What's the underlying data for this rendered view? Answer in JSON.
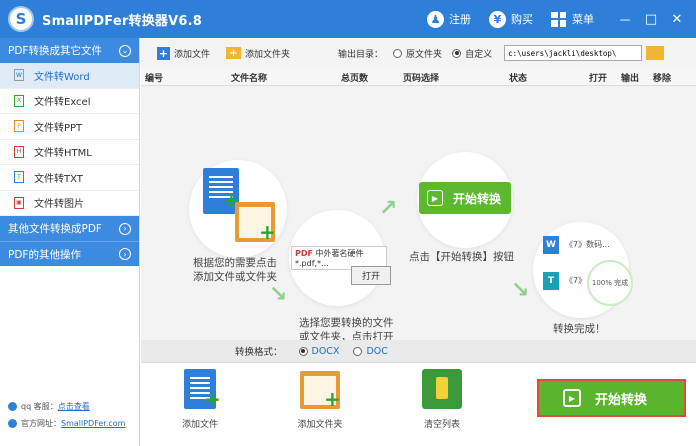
{
  "app": {
    "logo": "S",
    "title": "SmallPDFer转换器V6.8"
  },
  "titlebar": {
    "register": "注册",
    "buy": "购买",
    "menu": "菜单",
    "minimize": "－",
    "maximize": "□",
    "close": "✕"
  },
  "sidebar": {
    "groups": [
      {
        "label": "PDF转换成其它文件",
        "chev": "⌄"
      },
      {
        "label": "其他文件转换成PDF",
        "chev": "›"
      },
      {
        "label": "PDF的其他操作",
        "chev": "›"
      }
    ],
    "items": [
      {
        "label": "文件转Word",
        "icon": "W"
      },
      {
        "label": "文件转Excel",
        "icon": "X"
      },
      {
        "label": "文件转PPT",
        "icon": "P"
      },
      {
        "label": "文件转HTML",
        "icon": "H"
      },
      {
        "label": "文件转TXT",
        "icon": "T"
      },
      {
        "label": "文件转图片",
        "icon": "▣"
      }
    ],
    "footer": {
      "qq_label": "qq 客服：",
      "qq_link": "点击查看",
      "site_label": "官方网址：",
      "site_link": "SmallPDFer.com"
    }
  },
  "toolbar": {
    "add_file": "添加文件",
    "add_folder": "添加文件夹",
    "output_label": "输出目录：",
    "radio_original": "原文件夹",
    "radio_custom": "自定义",
    "path_value": "c:\\users\\jackli\\desktop\\"
  },
  "table": {
    "columns": [
      "编号",
      "文件名称",
      "总页数",
      "页码选择",
      "状态",
      "打开",
      "输出",
      "移除"
    ]
  },
  "steps": {
    "step1_line1": "根据您的需要点击",
    "step1_line2": "添加文件或文件夹",
    "step2_line1": "选择您要转换的文件",
    "step2_line2": "或文件夹，点击打开",
    "step2_file": "中外著名硬件*.pdf,*...",
    "step2_open": "打开",
    "step3_button": "开始转换",
    "step3_text": "点击【开始转换】按钮",
    "step4_doc1": "《7》数码...",
    "step4_doc2": "《7》...",
    "step4_progress": "100% 完成",
    "step4_text": "转换完成！"
  },
  "format_bar": {
    "label": "转换格式：",
    "opt_docx": "DOCX",
    "opt_doc": "DOC"
  },
  "bottom": {
    "add_file": "添加文件",
    "add_folder": "添加文件夹",
    "clear_list": "清空列表",
    "start": "开始转换"
  },
  "colors": {
    "primary": "#2e7fd8",
    "sidebar_group": "#3d8be0",
    "start_green": "#5ab52d",
    "highlight_red": "#e04b3a"
  }
}
